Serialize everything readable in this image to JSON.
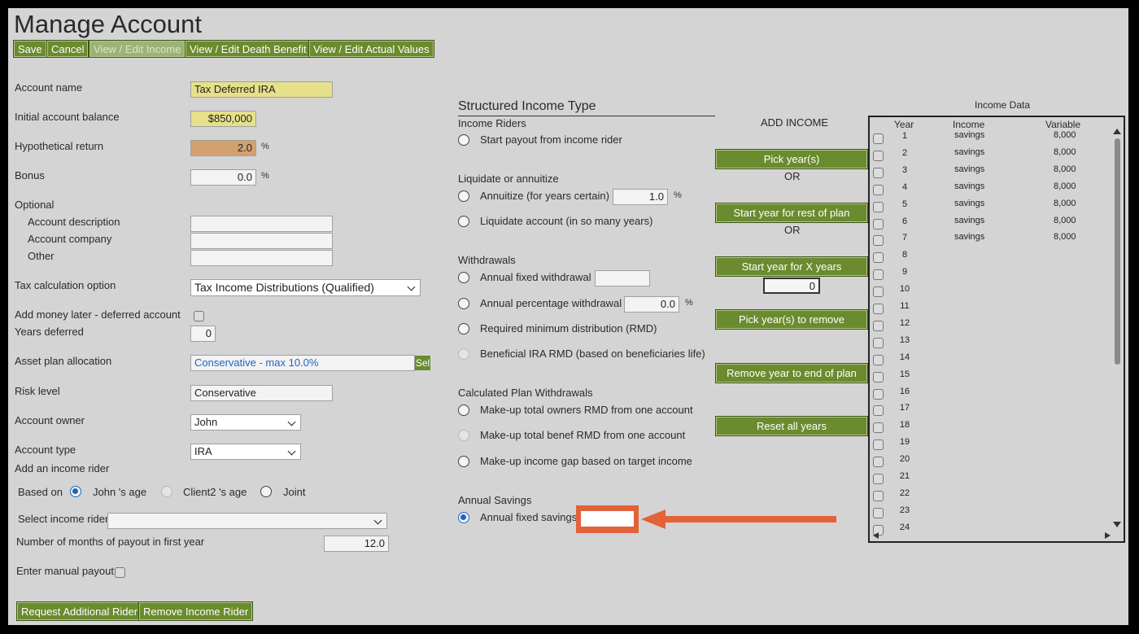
{
  "page_title": "Manage Account",
  "toolbar": {
    "save": "Save",
    "cancel": "Cancel",
    "view_edit_income": "View / Edit Income",
    "view_edit_death_benefit": "View / Edit Death Benefit",
    "view_edit_actual_values": "View / Edit Actual Values"
  },
  "account": {
    "name_label": "Account name",
    "name_value": "Tax Deferred IRA",
    "initial_balance_label": "Initial account balance",
    "initial_balance_value": "$850,000",
    "hypothetical_return_label": "Hypothetical return",
    "hypothetical_return_value": "2.0",
    "bonus_label": "Bonus",
    "bonus_value": "0.0",
    "percent_symbol": "%",
    "optional_label": "Optional",
    "description_label": "Account description",
    "company_label": "Account company",
    "other_label": "Other",
    "tax_calc_label": "Tax calculation option",
    "tax_calc_value": "Tax Income Distributions (Qualified)",
    "add_money_label": "Add money later - deferred account",
    "years_deferred_label": "Years deferred",
    "years_deferred_value": "0",
    "asset_plan_label": "Asset plan allocation",
    "asset_plan_value": "Conservative - max 10.0%",
    "asset_plan_button": "Sel",
    "risk_level_label": "Risk level",
    "risk_level_value": "Conservative",
    "owner_label": "Account owner",
    "owner_value": "John",
    "type_label": "Account type",
    "type_value": "IRA"
  },
  "rider": {
    "heading": "Add an income rider",
    "based_on_label": "Based on",
    "option_john": "John 's age",
    "option_client2": "Client2 's age",
    "option_joint": "Joint",
    "select_label": "Select income rider",
    "select_value": "",
    "months_label": "Number of months of payout in first year",
    "months_value": "12.0",
    "manual_payout_label": "Enter manual payout",
    "request_button": "Request Additional Rider",
    "remove_button": "Remove Income Rider"
  },
  "structured": {
    "title": "Structured Income Type",
    "riders_heading": "Income Riders",
    "start_payout": "Start payout from income rider",
    "liquidate_heading": "Liquidate or annuitize",
    "annuitize": "Annuitize (for years certain)",
    "annuitize_value": "1.0",
    "liquidate": "Liquidate account (in so many years)",
    "withdrawals_heading": "Withdrawals",
    "annual_fixed": "Annual fixed withdrawal",
    "annual_fixed_value": "",
    "annual_pct": "Annual percentage withdrawal",
    "annual_pct_value": "0.0",
    "rmd": "Required minimum distribution (RMD)",
    "beneficial": "Beneficial IRA RMD (based on beneficiaries life)",
    "calc_heading": "Calculated Plan Withdrawals",
    "makeup_owner": "Make-up total owners RMD from one account",
    "makeup_benef": "Make-up total benef RMD from one account",
    "makeup_gap": "Make-up income gap based on target income",
    "savings_heading": "Annual Savings",
    "annual_savings": "Annual fixed savings",
    "annual_savings_value": ""
  },
  "add_income": {
    "heading": "ADD INCOME",
    "pick_years": "Pick year(s)",
    "or1": "OR",
    "start_rest": "Start year for rest of plan",
    "or2": "OR",
    "start_x": "Start year for X years",
    "x_years_value": "0",
    "pick_remove": "Pick year(s) to remove",
    "remove_end": "Remove year to end of plan",
    "reset": "Reset all years"
  },
  "income_data": {
    "title": "Income Data",
    "col_year": "Year",
    "col_income": "Income",
    "col_variable": "Variable",
    "rows": [
      {
        "year": "1",
        "income": "savings",
        "variable": "8,000"
      },
      {
        "year": "2",
        "income": "savings",
        "variable": "8,000"
      },
      {
        "year": "3",
        "income": "savings",
        "variable": "8,000"
      },
      {
        "year": "4",
        "income": "savings",
        "variable": "8,000"
      },
      {
        "year": "5",
        "income": "savings",
        "variable": "8,000"
      },
      {
        "year": "6",
        "income": "savings",
        "variable": "8,000"
      },
      {
        "year": "7",
        "income": "savings",
        "variable": "8,000"
      },
      {
        "year": "8",
        "income": "",
        "variable": ""
      },
      {
        "year": "9",
        "income": "",
        "variable": ""
      },
      {
        "year": "10",
        "income": "",
        "variable": ""
      },
      {
        "year": "11",
        "income": "",
        "variable": ""
      },
      {
        "year": "12",
        "income": "",
        "variable": ""
      },
      {
        "year": "13",
        "income": "",
        "variable": ""
      },
      {
        "year": "14",
        "income": "",
        "variable": ""
      },
      {
        "year": "15",
        "income": "",
        "variable": ""
      },
      {
        "year": "16",
        "income": "",
        "variable": ""
      },
      {
        "year": "17",
        "income": "",
        "variable": ""
      },
      {
        "year": "18",
        "income": "",
        "variable": ""
      },
      {
        "year": "19",
        "income": "",
        "variable": ""
      },
      {
        "year": "20",
        "income": "",
        "variable": ""
      },
      {
        "year": "21",
        "income": "",
        "variable": ""
      },
      {
        "year": "22",
        "income": "",
        "variable": ""
      },
      {
        "year": "23",
        "income": "",
        "variable": ""
      },
      {
        "year": "24",
        "income": "",
        "variable": ""
      }
    ]
  },
  "colors": {
    "button_green": "#6a8b2e",
    "highlight_orange": "#e2623a",
    "field_yellow": "#e6e08a",
    "field_orange": "#d3a170",
    "radio_blue": "#1f63c4"
  }
}
